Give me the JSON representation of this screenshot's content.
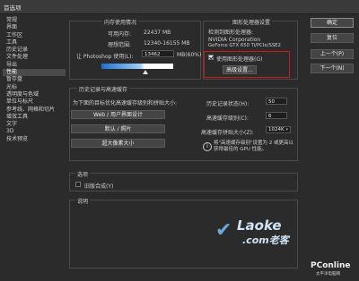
{
  "window": {
    "title": "首选项"
  },
  "sidebar": {
    "items": [
      {
        "label": "常规"
      },
      {
        "label": "界面"
      },
      {
        "label": "工作区"
      },
      {
        "label": "工具"
      },
      {
        "label": "历史记录"
      },
      {
        "label": "文件处理"
      },
      {
        "label": "导出"
      },
      {
        "label": "性能"
      },
      {
        "label": "暂存盘"
      },
      {
        "label": "光标"
      },
      {
        "label": "透明度与色域"
      },
      {
        "label": "单位与标尺"
      },
      {
        "label": "参考线、网格和切片"
      },
      {
        "label": "增效工具"
      },
      {
        "label": "文字"
      },
      {
        "label": "3D"
      },
      {
        "label": "技术预览"
      }
    ],
    "active_index": 7
  },
  "memory": {
    "title": "内存使用情况",
    "available_label": "可用内存:",
    "available_value": "22437 MB",
    "ideal_label": "理想范围:",
    "ideal_value": "12340-16155 MB",
    "use_label": "让 Photoshop 使用(L):",
    "use_value": "13462",
    "use_unit": "MB(60%)",
    "slider_percent": 60
  },
  "gpu": {
    "title": "图形处理器设置",
    "detected_label": "检测到图形处理器:",
    "vendor": "NVIDIA Corporation",
    "model": "GeForce GTX 650 Ti/PCIe/SSE2",
    "use_gpu_label": "使用图形处理器(G)",
    "use_gpu_checked": true,
    "advanced_button": "高级设置...",
    "highlight_color": "#d01818"
  },
  "history": {
    "title": "历史记录与高速缓存",
    "optimize_label": "为下面的目标优化高速缓存级别和拼贴大小:",
    "presets": [
      "Web / 用户界面设计",
      "默认 / 照片",
      "超大像素大小"
    ],
    "states_label": "历史记录状态(H):",
    "states_value": "50",
    "cache_levels_label": "高速缓存级别(C):",
    "cache_levels_value": "6",
    "tile_size_label": "高速缓存拼贴大小(Z):",
    "tile_size_value": "1024K",
    "info_text": "将\"高速缓存级别\"设置为 2 或更高以获得最佳的 GPU 性能。"
  },
  "options": {
    "title": "选项",
    "legacy_label": "旧版合成(Y)",
    "legacy_checked": false
  },
  "description": {
    "title": "说明"
  },
  "buttons": {
    "ok": "确定",
    "cancel": "复位",
    "prev": "上一个(P)",
    "next": "下一个(N)"
  },
  "watermarks": {
    "laoke": "Laoke",
    "laoke_sub": ".com老客",
    "pconline": "PConline",
    "pconline_sub": "太平洋电脑网"
  }
}
